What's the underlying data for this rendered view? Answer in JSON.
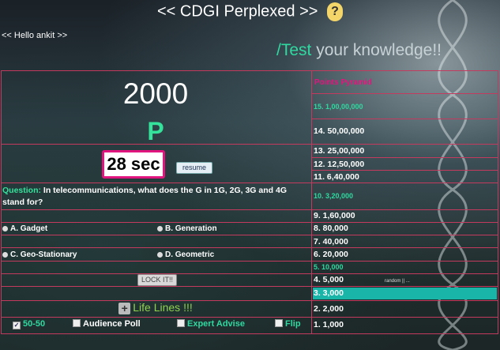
{
  "header": {
    "title": "<< CDGI Perplexed >>",
    "help_icon": "?"
  },
  "greeting": "<< Hello ankit >>",
  "tagline": {
    "accent": "/Test",
    "rest": " your knowledge!!"
  },
  "game": {
    "score": "2000",
    "level_letter": "P",
    "timer": "28 sec",
    "resume_label": "resume"
  },
  "question": {
    "label": "Question:",
    "text": "In telecommunications, what does the G in 1G, 2G, 3G and 4G stand for?",
    "options": {
      "a": "A. Gadget",
      "b": "B. Generation",
      "c": "C. Geo-Stationary",
      "d": "D. Geometric"
    },
    "lock_label": "LOCK IT!!"
  },
  "lifelines": {
    "title": "Life Lines !!!",
    "fifty": "50-50",
    "audience": "Audience Poll",
    "expert": "Expert Advise",
    "flip": "Flip"
  },
  "pyramid": {
    "title": "Points Pyramid",
    "levels": [
      "15. 1,00,00,000",
      "14. 50,00,000",
      "13. 25,00,000",
      "12. 12,50,000",
      "11. 6,40,000",
      "10. 3,20,000",
      "9. 1,60,000",
      "8. 80,000",
      "7. 40,000",
      "6. 20,000",
      "5. 10,000",
      "4. 5,000",
      "3. 3,000",
      "2. 2,000",
      "1. 1,000"
    ]
  },
  "watermark": "random || ..."
}
